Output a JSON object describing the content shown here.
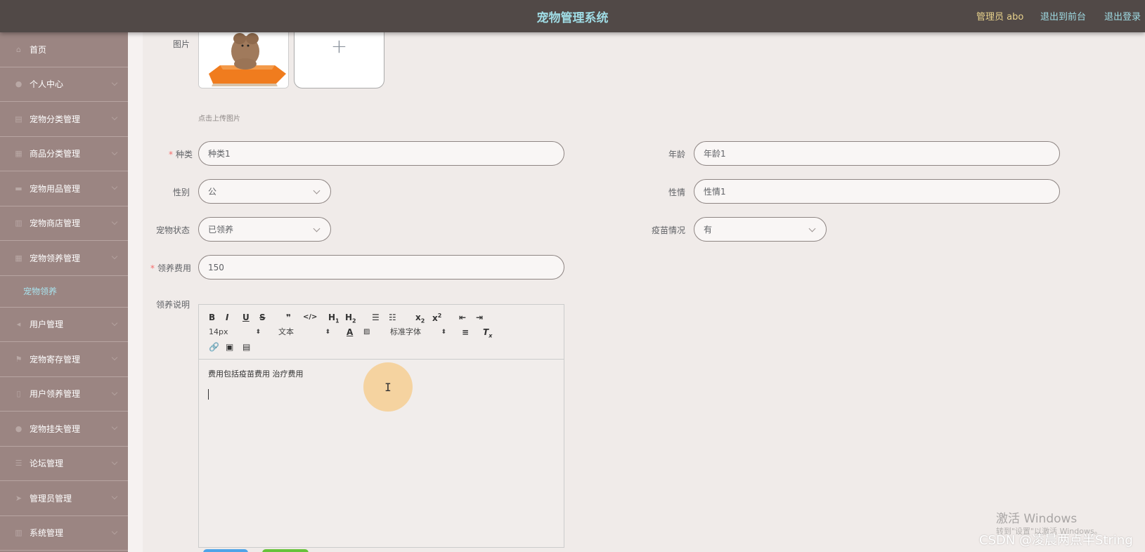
{
  "header": {
    "title": "宠物管理系统",
    "admin_text": "管理员 abo",
    "front_link": "退出到前台",
    "logout_link": "退出登录"
  },
  "sidebar": {
    "items": [
      {
        "label": "首页",
        "icon": "home-icon",
        "chevron": false
      },
      {
        "label": "个人中心",
        "icon": "user-icon",
        "chevron": true
      },
      {
        "label": "宠物分类管理",
        "icon": "category-icon",
        "chevron": true
      },
      {
        "label": "商品分类管理",
        "icon": "grid-icon",
        "chevron": true
      },
      {
        "label": "宠物用品管理",
        "icon": "goods-icon",
        "chevron": true
      },
      {
        "label": "宠物商店管理",
        "icon": "shop-icon",
        "chevron": true
      },
      {
        "label": "宠物领养管理",
        "icon": "adopt-icon",
        "chevron": true
      }
    ],
    "active_sub": "宠物领养",
    "items_after": [
      {
        "label": "用户管理",
        "icon": "users-icon",
        "chevron": true
      },
      {
        "label": "宠物寄存管理",
        "icon": "flag-icon",
        "chevron": true
      },
      {
        "label": "用户领养管理",
        "icon": "doc-icon",
        "chevron": true
      },
      {
        "label": "宠物挂失管理",
        "icon": "person-icon",
        "chevron": true
      },
      {
        "label": "论坛管理",
        "icon": "list-icon",
        "chevron": true
      },
      {
        "label": "管理员管理",
        "icon": "send-icon",
        "chevron": true
      },
      {
        "label": "系统管理",
        "icon": "settings-icon",
        "chevron": true
      }
    ]
  },
  "form": {
    "image_label": "图片",
    "upload_hint": "点击上传图片",
    "species_label": "种类",
    "species_value": "种类1",
    "age_label": "年龄",
    "age_value": "年龄1",
    "gender_label": "性别",
    "gender_value": "公",
    "temper_label": "性情",
    "temper_value": "性情1",
    "status_label": "宠物状态",
    "status_value": "已领养",
    "vaccine_label": "疫苗情况",
    "vaccine_value": "有",
    "fee_label": "领养费用",
    "fee_value": "150",
    "desc_label": "领养说明"
  },
  "editor": {
    "font_size": "14px",
    "block_type": "文本",
    "font_family": "标准字体",
    "content": "费用包括疫苗费用 治疗费用"
  },
  "watermark": {
    "activate": "激活 Windows",
    "activate_sub": "转到\"设置\"以激活 Windows。",
    "csdn": "CSDN @凌晨两点半String"
  }
}
